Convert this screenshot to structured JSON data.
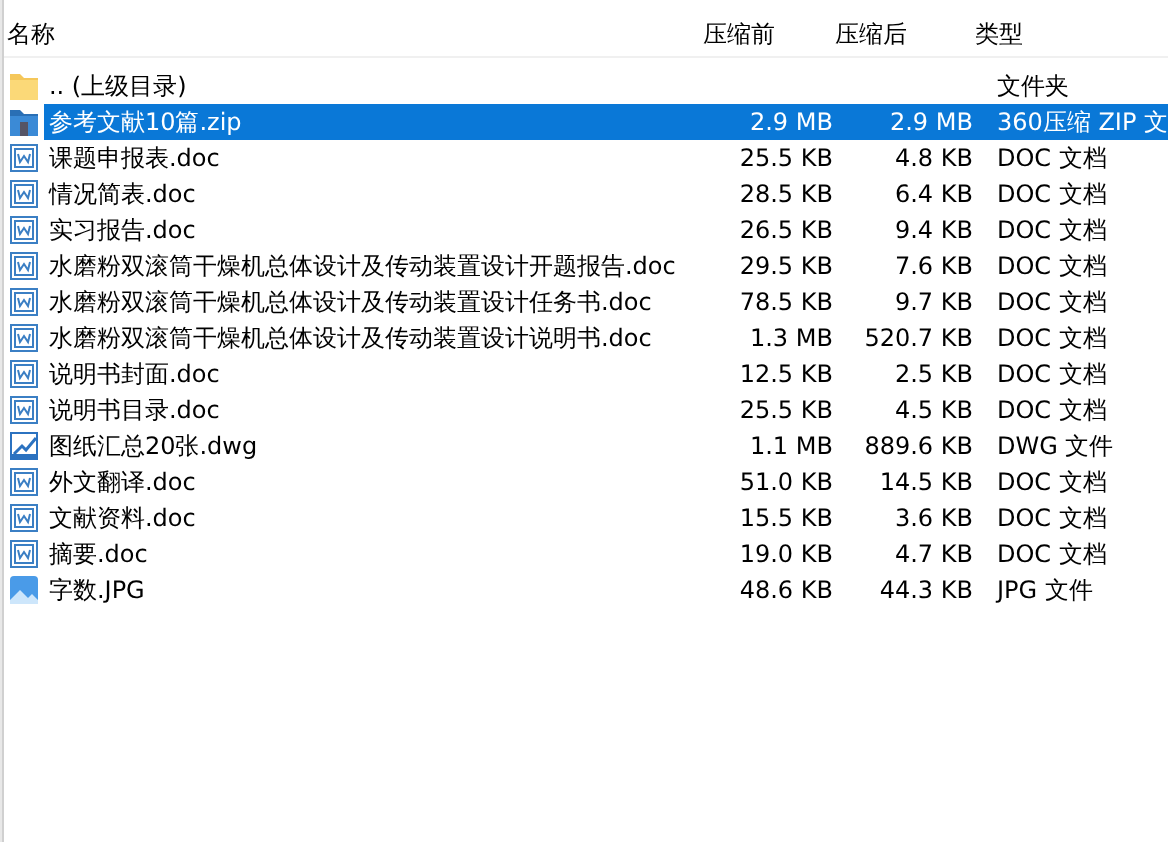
{
  "table": {
    "columns": [
      "名称",
      "压缩前",
      "压缩后",
      "类型"
    ],
    "rows": [
      {
        "kind": "folder",
        "name": ".. (上级目录)",
        "type": "文件夹",
        "selected": false
      },
      {
        "kind": "zip",
        "name": "参考文献10篇.zip",
        "before": "2.9 MB",
        "after": "2.9 MB",
        "type": "360压缩 ZIP 文",
        "selected": true
      },
      {
        "kind": "doc",
        "name": "课题申报表.doc",
        "before": "25.5 KB",
        "after": "4.8 KB",
        "type": "DOC 文档",
        "selected": false
      },
      {
        "kind": "doc",
        "name": "情况简表.doc",
        "before": "28.5 KB",
        "after": "6.4 KB",
        "type": "DOC 文档",
        "selected": false
      },
      {
        "kind": "doc",
        "name": "实习报告.doc",
        "before": "26.5 KB",
        "after": "9.4 KB",
        "type": "DOC 文档",
        "selected": false
      },
      {
        "kind": "doc",
        "name": "水磨粉双滚筒干燥机总体设计及传动装置设计开题报告.doc",
        "before": "29.5 KB",
        "after": "7.6 KB",
        "type": "DOC 文档",
        "selected": false
      },
      {
        "kind": "doc",
        "name": "水磨粉双滚筒干燥机总体设计及传动装置设计任务书.doc",
        "before": "78.5 KB",
        "after": "9.7 KB",
        "type": "DOC 文档",
        "selected": false
      },
      {
        "kind": "doc",
        "name": "水磨粉双滚筒干燥机总体设计及传动装置设计说明书.doc",
        "before": "1.3 MB",
        "after": "520.7 KB",
        "type": "DOC 文档",
        "selected": false
      },
      {
        "kind": "doc",
        "name": "说明书封面.doc",
        "before": "12.5 KB",
        "after": "2.5 KB",
        "type": "DOC 文档",
        "selected": false
      },
      {
        "kind": "doc",
        "name": "说明书目录.doc",
        "before": "25.5 KB",
        "after": "4.5 KB",
        "type": "DOC 文档",
        "selected": false
      },
      {
        "kind": "dwg",
        "name": "图纸汇总20张.dwg",
        "before": "1.1 MB",
        "after": "889.6 KB",
        "type": "DWG 文件",
        "selected": false
      },
      {
        "kind": "doc",
        "name": "外文翻译.doc",
        "before": "51.0 KB",
        "after": "14.5 KB",
        "type": "DOC 文档",
        "selected": false
      },
      {
        "kind": "doc",
        "name": "文献资料.doc",
        "before": "15.5 KB",
        "after": "3.6 KB",
        "type": "DOC 文档",
        "selected": false
      },
      {
        "kind": "doc",
        "name": "摘要.doc",
        "before": "19.0 KB",
        "after": "4.7 KB",
        "type": "DOC 文档",
        "selected": false
      },
      {
        "kind": "image",
        "name": "字数.JPG",
        "before": "48.6 KB",
        "after": "44.3 KB",
        "type": "JPG 文件",
        "selected": false
      }
    ]
  }
}
